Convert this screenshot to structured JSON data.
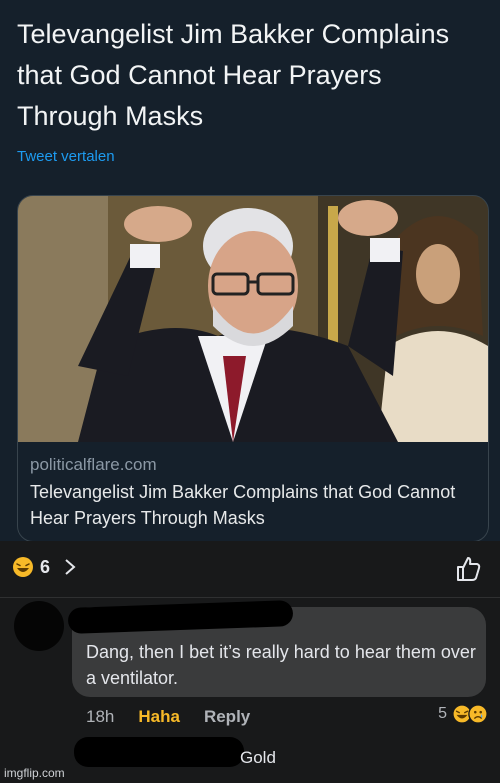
{
  "tweet": {
    "title": "Televangelist Jim Bakker Complains that God Cannot Hear Prayers Through Masks",
    "translate_link": "Tweet vertalen",
    "card": {
      "domain": "politicalflare.com",
      "headline": "Televangelist Jim Bakker Complains that God Cannot Hear Prayers Through Masks"
    }
  },
  "reactions": {
    "count": "6",
    "icons": [
      "laugh-emoji-icon"
    ]
  },
  "comment": {
    "text": "Dang, then I bet it’s really hard to hear them over a ventilator.",
    "time": "18h",
    "haha_label": "Haha",
    "reply_label": "Reply",
    "reaction_count": "5",
    "reaction_icons": [
      "laugh-emoji-icon",
      "sad-emoji-icon"
    ]
  },
  "next_comment": {
    "text": "Gold"
  },
  "watermark": "imgflip.com",
  "colors": {
    "twitter_bg": "#15202b",
    "link": "#1d9bf0",
    "fb_bg": "#18191a",
    "bubble": "#3a3b3c",
    "haha": "#f7b928"
  }
}
